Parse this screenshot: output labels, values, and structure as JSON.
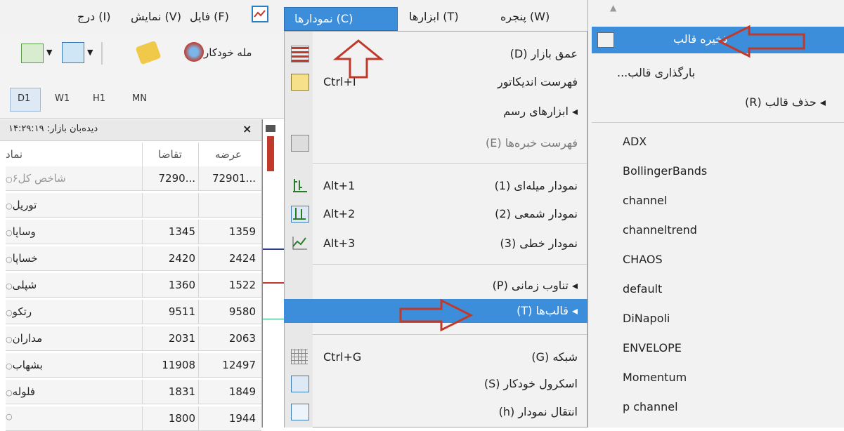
{
  "menubar": {
    "items": [
      "فایل (F)",
      "نمایش (V)",
      "درج (I)",
      "نمودارها (C)",
      "ابزارها (T)",
      "پنجره (W)"
    ]
  },
  "toolbar": {
    "auto_trade_label": "مله خودکار"
  },
  "timeframes": [
    "D1",
    "W1",
    "H1",
    "MN"
  ],
  "market_watch": {
    "title": "دیده‌بان بازار: ۱۴:۲۹:۱۹",
    "close": "×",
    "headers": {
      "symbol": "نماد",
      "bid": "تقاضا",
      "ask": "عرضه"
    },
    "rows": [
      {
        "symbol": "شاخص کل۶",
        "bid": "7290...",
        "ask": "72901..."
      },
      {
        "symbol": "توریل",
        "bid": "",
        "ask": ""
      },
      {
        "symbol": "وساپا",
        "bid": "1345",
        "ask": "1359"
      },
      {
        "symbol": "خساپا",
        "bid": "2420",
        "ask": "2424"
      },
      {
        "symbol": "شپلی",
        "bid": "1360",
        "ask": "1522"
      },
      {
        "symbol": "رتکو",
        "bid": "9511",
        "ask": "9580"
      },
      {
        "symbol": "مداران",
        "bid": "2031",
        "ask": "2063"
      },
      {
        "symbol": "بشهاب",
        "bid": "11908",
        "ask": "12497"
      },
      {
        "symbol": "فلوله",
        "bid": "1831",
        "ask": "1849"
      },
      {
        "symbol": "",
        "bid": "1800",
        "ask": "1944"
      }
    ]
  },
  "charts_menu": {
    "items": [
      {
        "label": "عمق بازار (D)",
        "shortcut": ""
      },
      {
        "label": "فهرست اندیکاتور",
        "shortcut": "Ctrl+I"
      },
      {
        "label": "◂ ابزارهای رسم",
        "shortcut": ""
      },
      {
        "label": "فهرست خبره‌ها (E)",
        "shortcut": ""
      },
      {
        "label": "نمودار میله‌ای (1)",
        "shortcut": "Alt+1"
      },
      {
        "label": "نمودار شمعی (2)",
        "shortcut": "Alt+2"
      },
      {
        "label": "نمودار خطی (3)",
        "shortcut": "Alt+3"
      },
      {
        "label": "◂ تناوب زمانی (P)",
        "shortcut": ""
      },
      {
        "label": "◂ قالب‌ها (T)",
        "shortcut": ""
      },
      {
        "label": "شبکه (G)",
        "shortcut": "Ctrl+G"
      },
      {
        "label": "اسکرول خودکار (S)",
        "shortcut": ""
      },
      {
        "label": "انتقال نمودار (h)",
        "shortcut": ""
      }
    ]
  },
  "templates_submenu": {
    "save": "ذخیره قالب",
    "load": "بارگذاری قالب...",
    "delete": "◂ حذف قالب (R)",
    "templates": [
      "ADX",
      "BollingerBands",
      "channel",
      "channeltrend",
      "CHAOS",
      "default",
      "DiNapoli",
      "ENVELOPE",
      "Momentum",
      "p channel"
    ]
  },
  "colors": {
    "highlight": "#3c8edb",
    "annotation_arrow": "#c0392b"
  }
}
